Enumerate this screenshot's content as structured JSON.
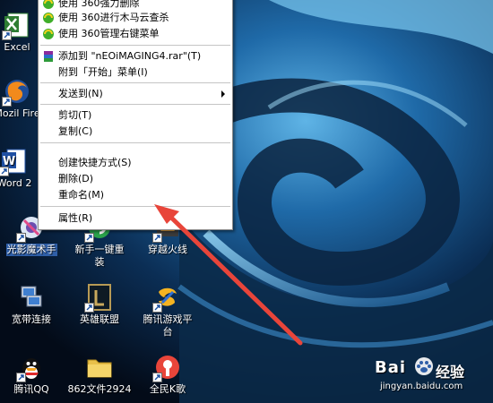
{
  "context_menu": {
    "items": [
      {
        "label": "使用 360强力删除",
        "icon": "360-icon"
      },
      {
        "label": "使用 360进行木马云查杀",
        "icon": "360-icon"
      },
      {
        "label": "使用 360管理右键菜单",
        "icon": "360-icon"
      },
      {
        "label": "添加到 \"nEOiMAGING4.rar\"(T)",
        "icon": "winrar-icon"
      },
      {
        "label": "附到「开始」菜单(I)",
        "icon": null
      },
      {
        "label": "发送到(N)",
        "icon": null,
        "submenu": true
      },
      {
        "label": "剪切(T)",
        "icon": null
      },
      {
        "label": "复制(C)",
        "icon": null
      },
      {
        "label": "创建快捷方式(S)",
        "icon": null
      },
      {
        "label": "删除(D)",
        "icon": null
      },
      {
        "label": "重命名(M)",
        "icon": null
      },
      {
        "label": "属性(R)",
        "icon": null
      }
    ]
  },
  "desktop_icons": [
    {
      "label": "Excel",
      "icon": "excel-icon"
    },
    {
      "label": "Mozil Fire",
      "icon": "firefox-icon"
    },
    {
      "label": "Word 2",
      "icon": "word-icon"
    },
    {
      "label": "光影魔术手",
      "icon": "neoimaging-icon",
      "selected": true
    },
    {
      "label": "新手一键重装",
      "icon": "reinstall-icon"
    },
    {
      "label": "穿越火线",
      "icon": "crossfire-icon"
    },
    {
      "label": "宽带连接",
      "icon": "broadband-icon"
    },
    {
      "label": "英雄联盟",
      "icon": "lol-icon"
    },
    {
      "label": "腾讯游戏平台",
      "icon": "tencent-games-icon"
    },
    {
      "label": "腾讯QQ",
      "icon": "qq-icon"
    },
    {
      "label": "862文件2924",
      "icon": "folder-icon"
    },
    {
      "label": "全民K歌",
      "icon": "karaoke-icon"
    }
  ],
  "watermark": {
    "logo": "Bai",
    "site": "经验",
    "url": "jingyan.baidu.com"
  },
  "colors": {
    "selection": "#2f5fa8",
    "arrow": "#e8453a",
    "menu_bg": "#ffffff"
  }
}
